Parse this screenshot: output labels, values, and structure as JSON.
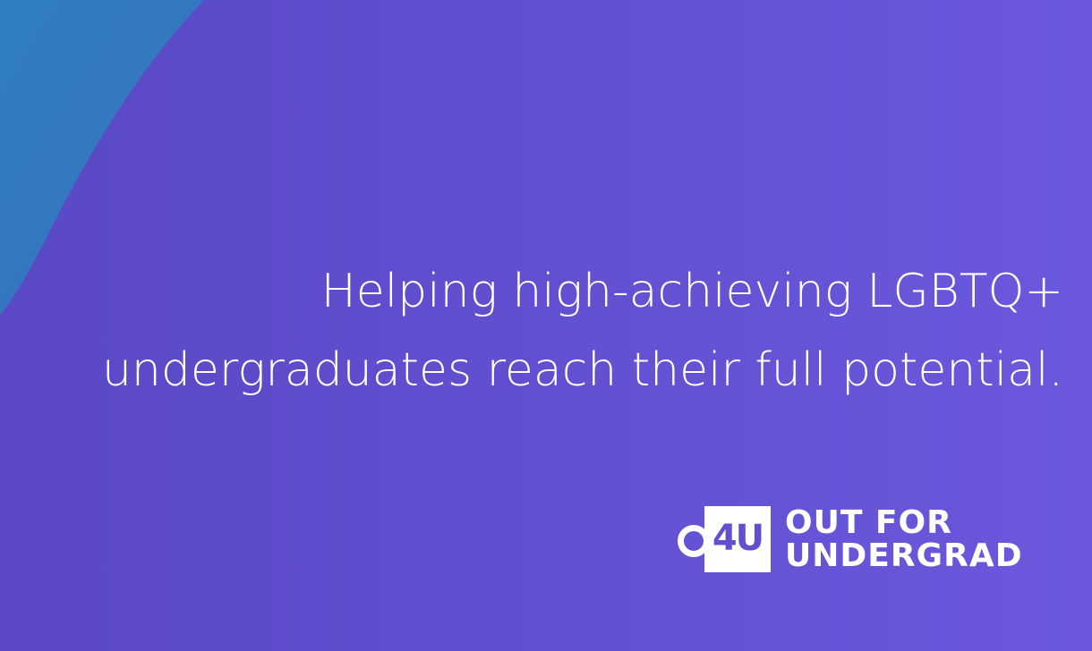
{
  "tagline": {
    "line1": "Helping high-achieving LGBTQ+",
    "line2": "undergraduates reach their full potential."
  },
  "logo": {
    "mark_text": "4U",
    "mark_o": "O",
    "word_line1": "OUT FOR",
    "word_line2": "UNDERGRAD"
  },
  "colors": {
    "background": "#6050d0",
    "accent_wave": "#3a7fc4",
    "text": "#ffffff"
  }
}
